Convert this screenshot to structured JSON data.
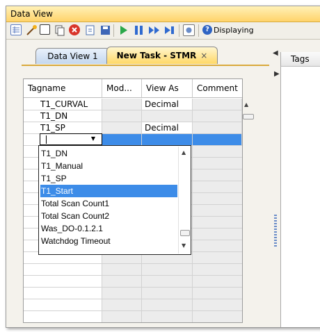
{
  "window": {
    "title": "Data View"
  },
  "toolbar": {
    "status_text": "Displaying",
    "help_glyph": "?",
    "icons": [
      "grid-icon",
      "wand-icon",
      "square-icon",
      "copy-icon",
      "delete-icon",
      "doc-icon",
      "save-icon",
      "play-icon",
      "pause-icon",
      "fast-forward-icon",
      "step-icon",
      "snapshot-icon",
      "help-icon"
    ]
  },
  "tabs": [
    {
      "label": "Data View 1",
      "active": false
    },
    {
      "label": "New Task - STMR",
      "active": true,
      "close": "×"
    }
  ],
  "tags_panel": {
    "title": "Tags"
  },
  "grid": {
    "columns": [
      "Tagname",
      "Mod...",
      "View As",
      "Comment"
    ],
    "rows": [
      {
        "tagname": "T1_CURVAL",
        "modified": "",
        "view_as": "Decimal",
        "comment": ""
      },
      {
        "tagname": "T1_DN",
        "modified": "",
        "view_as": "",
        "comment": ""
      },
      {
        "tagname": "T1_SP",
        "modified": "",
        "view_as": "Decimal",
        "comment": ""
      }
    ],
    "editing_value": ""
  },
  "dropdown": {
    "items": [
      "T1_DN",
      "T1_Manual",
      "T1_SP",
      "T1_Start",
      "Total Scan Count1",
      "Total Scan Count2",
      "Was_DO-0.1.2.1",
      "Watchdog Timeout"
    ],
    "selected": "T1_Start"
  },
  "colors": {
    "title_bar": "#ffd36a",
    "selection": "#3d8ce8",
    "active_tab": "#ffd866"
  }
}
